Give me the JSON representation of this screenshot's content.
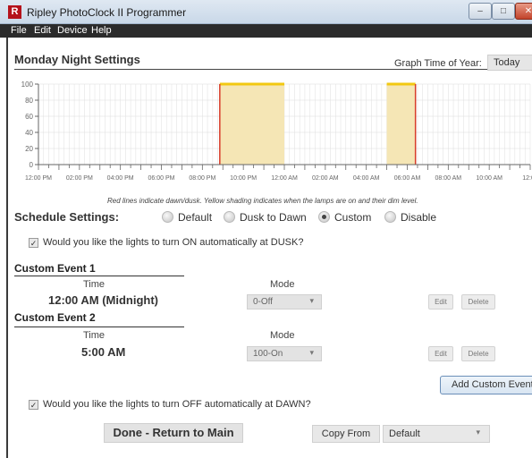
{
  "window": {
    "title": "Ripley PhotoClock II Programmer",
    "icon_letter": "R"
  },
  "menu": [
    "File",
    "Edit",
    "Device",
    "Help"
  ],
  "header": {
    "title": "Monday Night Settings",
    "graph_label": "Graph Time of Year:",
    "graph_value": "Today"
  },
  "chart_data": {
    "type": "area",
    "yticks": [
      "100",
      "80",
      "60",
      "40",
      "20",
      "0"
    ],
    "ylim": [
      0,
      100
    ],
    "xticks": [
      "12:00 PM",
      "02:00 PM",
      "04:00 PM",
      "06:00 PM",
      "08:00 PM",
      "10:00 PM",
      "12:00 AM",
      "02:00 AM",
      "04:00 AM",
      "06:00 AM",
      "08:00 AM",
      "10:00 AM",
      "12:00"
    ],
    "shaded_periods": [
      {
        "start_hours_after_noon": 8.85,
        "end_hours_after_noon": 12.0,
        "level": 100
      },
      {
        "start_hours_after_noon": 17.0,
        "end_hours_after_noon": 18.4,
        "level": 100
      }
    ],
    "dusk_dawn_lines_hours_after_noon": [
      8.85,
      18.4
    ],
    "shading_color": "#f5e6b5",
    "level_line_color": "#f2c811",
    "dusk_dawn_color": "#d83c2a",
    "grid": true,
    "caption": "Red lines indicate dawn/dusk. Yellow shading indicates when the lamps are on and their dim level."
  },
  "schedule": {
    "label": "Schedule Settings:",
    "options": [
      {
        "label": "Default",
        "selected": false
      },
      {
        "label": "Dusk to Dawn",
        "selected": false
      },
      {
        "label": "Custom",
        "selected": true
      },
      {
        "label": "Disable",
        "selected": false
      }
    ]
  },
  "dusk_question": "Would you like the lights to turn ON automatically at DUSK?",
  "dawn_question": "Would you like the lights to turn OFF automatically at DAWN?",
  "events": [
    {
      "title": "Custom Event 1",
      "time_header": "Time",
      "mode_header": "Mode",
      "time": "12:00 AM (Midnight)",
      "mode": "0-Off",
      "edit": "Edit",
      "delete": "Delete"
    },
    {
      "title": "Custom Event 2",
      "time_header": "Time",
      "mode_header": "Mode",
      "time": "5:00 AM",
      "mode": "100-On",
      "edit": "Edit",
      "delete": "Delete"
    }
  ],
  "buttons": {
    "add": "Add Custom Event",
    "done": "Done - Return to Main",
    "copy_from": "Copy From",
    "copy_select": "Default"
  }
}
